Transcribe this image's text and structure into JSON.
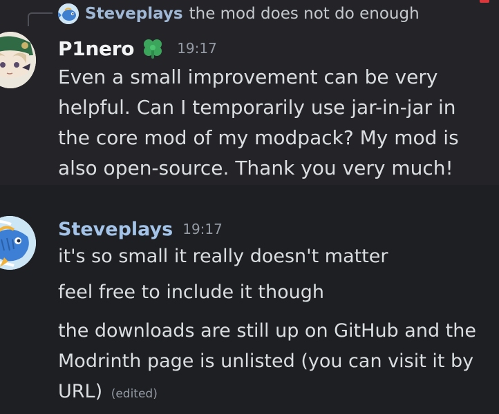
{
  "message1": {
    "reply": {
      "username": "Steveplays",
      "preview": "the mod does not do enough"
    },
    "author": "P1nero",
    "timestamp": "19:17",
    "content": "Even a small improvement can be very helpful. Can I temporarily use jar-in-jar in the core mod of my modpack? My mod is also open-source. Thank you very much!"
  },
  "message2": {
    "author": "Steveplays",
    "timestamp": "19:17",
    "lines": [
      "it's so small it really doesn't matter",
      "feel free to include it though",
      "the downloads are still up on GitHub and the Modrinth page is unlisted (you can visit it by URL)"
    ],
    "edited_label": "(edited)"
  },
  "colors": {
    "background": "#1e1f22",
    "highlight": "#242428",
    "username_blue": "#a3c4e8",
    "clover_green": "#3ba55c",
    "timestamp": "#949ba4"
  },
  "icons": {
    "server_tag_badge": "clover-icon"
  }
}
